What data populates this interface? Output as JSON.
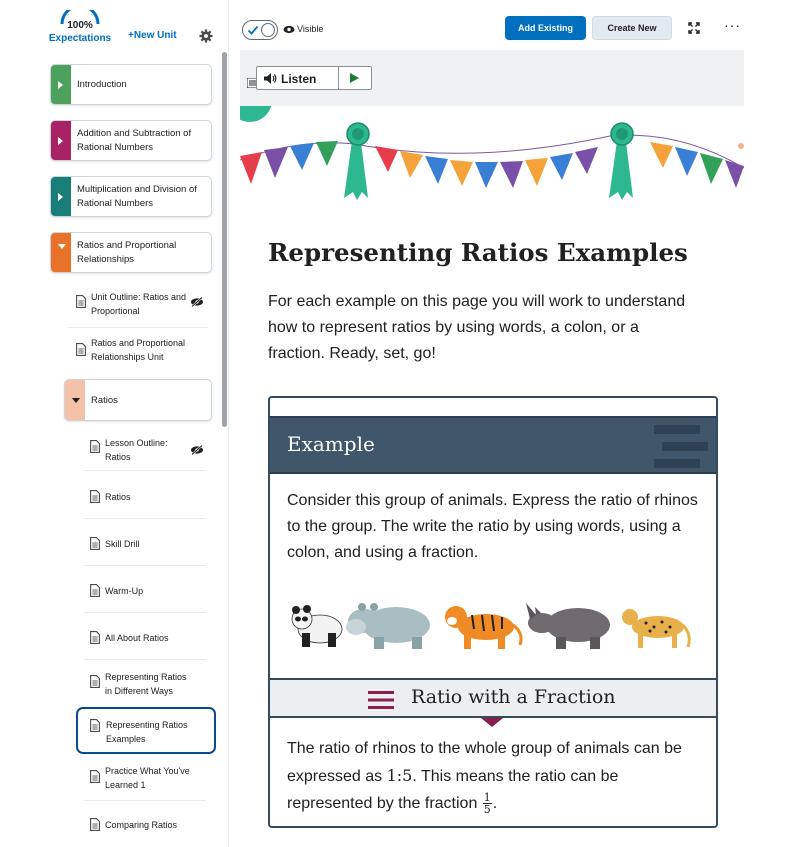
{
  "sidebar": {
    "expectations_percent": "100%",
    "expectations_label": "Expectations",
    "new_unit_label": "+New Unit",
    "units": [
      {
        "title": "Introduction",
        "color": "#4ca15c",
        "state": "collapsed"
      },
      {
        "title": "Addition and Subtraction of Rational Numbers",
        "color": "#a82266",
        "state": "collapsed"
      },
      {
        "title": "Multiplication and Division of Rational Numbers",
        "color": "#1a7e78",
        "state": "collapsed"
      },
      {
        "title": "Ratios and Proportional Relationships",
        "color": "#e8722a",
        "state": "expanded"
      }
    ],
    "topics": [
      {
        "title": "Unit Outline: Ratios and Proportional Relationships",
        "hidden": true
      },
      {
        "title": "Ratios and Proportional Relationships Unit Introduction",
        "hidden": false
      }
    ],
    "subunit": {
      "title": "Ratios",
      "color": "#f4c2a8",
      "state": "expanded"
    },
    "lessons": [
      {
        "title": "Lesson Outline: Ratios",
        "hidden": true
      },
      {
        "title": "Ratios",
        "hidden": false
      },
      {
        "title": "Skill Drill",
        "hidden": false
      },
      {
        "title": "Warm-Up",
        "hidden": false
      },
      {
        "title": "All About Ratios",
        "hidden": false
      },
      {
        "title": "Representing Ratios in Different Ways",
        "hidden": false
      },
      {
        "title": "Representing Ratios Examples",
        "hidden": false,
        "active": true
      },
      {
        "title": "Practice What You've Learned 1",
        "hidden": false
      },
      {
        "title": "Comparing Ratios",
        "hidden": false
      }
    ]
  },
  "toolbar": {
    "visible_label": "Visible",
    "add_existing_label": "Add Existing",
    "create_new_label": "Create New",
    "more_label": "···"
  },
  "listen": {
    "label": "Listen"
  },
  "content": {
    "title": "Representing Ratios Examples",
    "intro": "For each example on this page you will work to understand how to represent ratios by using words, a colon, or a fraction. Ready, set, go!",
    "example": {
      "heading": "Example",
      "prompt": "Consider this group of animals. Express the ratio of rhinos to the group. The write the ratio by using words, using a colon, and using a fraction.",
      "animals": [
        "panda",
        "hippo",
        "tiger",
        "rhino",
        "cheetah"
      ],
      "section_title": "Ratio with a Fraction",
      "answer_part1": "The ratio of rhinos to the whole group of animals can be expressed as ",
      "answer_math": "1:5",
      "answer_part2": ". This means the ratio can be represented by the fraction ",
      "fraction_num": "1",
      "fraction_den": "5",
      "answer_part3": "."
    }
  },
  "colors": {
    "primary": "#006fbf",
    "header_slate": "#3f566b",
    "accent_maroon": "#8a1e4f"
  }
}
